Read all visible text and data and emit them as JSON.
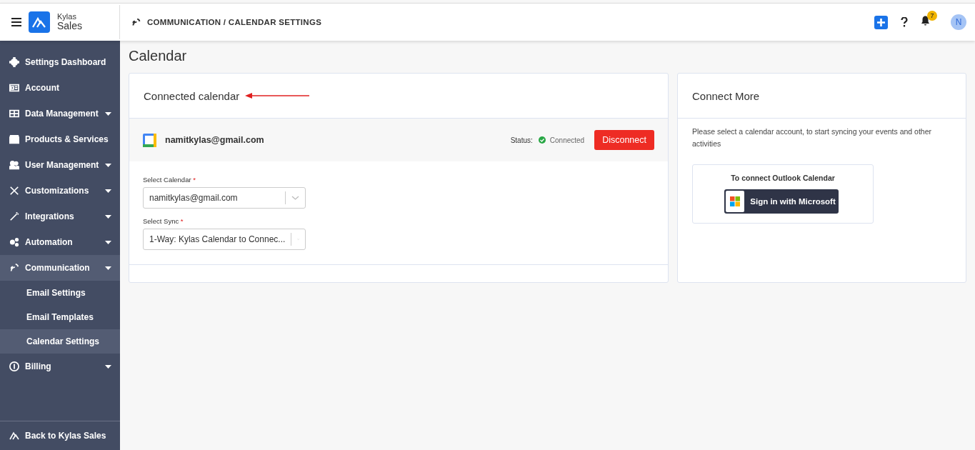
{
  "header": {
    "brand_small": "Kylas",
    "brand_large": "Sales",
    "breadcrumb": "COMMUNICATION / CALENDAR SETTINGS",
    "notification_count": "7",
    "avatar_initial": "N"
  },
  "sidebar": {
    "items": [
      {
        "label": "Settings Dashboard",
        "kind": "gear",
        "has_caret": false,
        "selected": false
      },
      {
        "label": "Account",
        "kind": "card",
        "has_caret": false,
        "selected": false
      },
      {
        "label": "Data Management",
        "kind": "table",
        "has_caret": true,
        "selected": false
      },
      {
        "label": "Products & Services",
        "kind": "box",
        "has_caret": false,
        "selected": false
      },
      {
        "label": "User Management",
        "kind": "users",
        "has_caret": true,
        "selected": false
      },
      {
        "label": "Customizations",
        "kind": "tools",
        "has_caret": true,
        "selected": false
      },
      {
        "label": "Integrations",
        "kind": "wand",
        "has_caret": true,
        "selected": false
      },
      {
        "label": "Automation",
        "kind": "cogs",
        "has_caret": true,
        "selected": false
      },
      {
        "label": "Communication",
        "kind": "satellite",
        "has_caret": true,
        "selected": true,
        "children": [
          {
            "label": "Email Settings",
            "selected": false
          },
          {
            "label": "Email Templates",
            "selected": false
          },
          {
            "label": "Calendar Settings",
            "selected": true
          }
        ]
      },
      {
        "label": "Billing",
        "kind": "coin",
        "has_caret": true,
        "selected": false
      }
    ],
    "footer": "Back to Kylas Sales"
  },
  "page_title": "Calendar",
  "connected": {
    "title": "Connected calendar",
    "email": "namitkylas@gmail.com",
    "status_label": "Status:",
    "status": "Connected",
    "disconnect": "Disconnect",
    "fields": [
      {
        "label": "Select Calendar",
        "required_mark": "*",
        "value": "namitkylas@gmail.com"
      },
      {
        "label": "Select Sync",
        "required_mark": "*",
        "value": "1-Way: Kylas Calendar to Connec..."
      }
    ]
  },
  "connect_more": {
    "title": "Connect More",
    "description": "Please select a calendar account, to start syncing your events and other activities",
    "outlook_label": "To connect Outlook Calendar",
    "signin": "Sign in with Microsoft"
  }
}
